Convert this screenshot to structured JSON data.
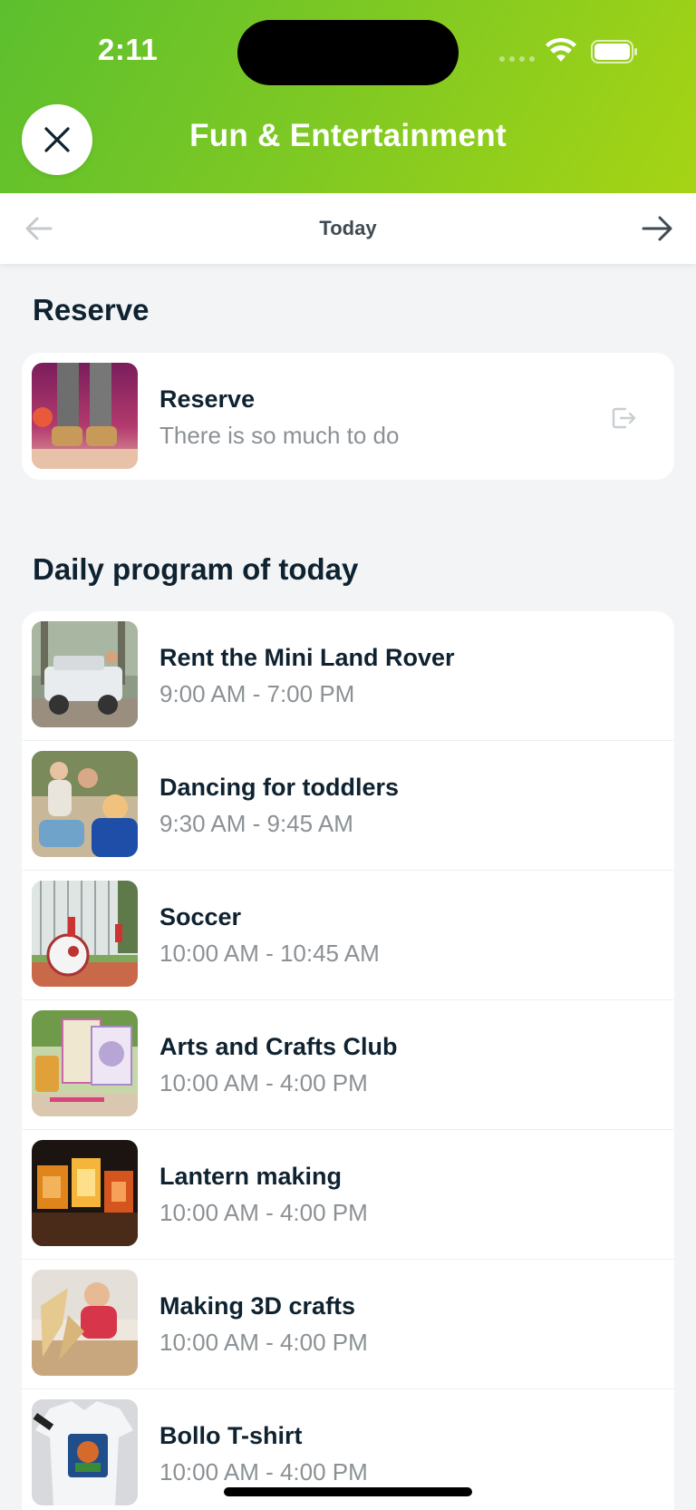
{
  "status_bar": {
    "time": "2:11"
  },
  "header": {
    "title": "Fun & Entertainment"
  },
  "date_nav": {
    "label": "Today"
  },
  "reserve_section": {
    "title": "Reserve",
    "item": {
      "title": "Reserve",
      "subtitle": "There is so much to do"
    }
  },
  "program_section": {
    "title": "Daily program of today",
    "items": [
      {
        "title": "Rent the Mini Land Rover",
        "time": "9:00 AM - 7:00 PM"
      },
      {
        "title": "Dancing for toddlers",
        "time": "9:30 AM - 9:45 AM"
      },
      {
        "title": "Soccer",
        "time": "10:00 AM - 10:45 AM"
      },
      {
        "title": "Arts and Crafts Club",
        "time": "10:00 AM - 4:00 PM"
      },
      {
        "title": "Lantern making",
        "time": "10:00 AM - 4:00 PM"
      },
      {
        "title": "Making 3D crafts",
        "time": "10:00 AM - 4:00 PM"
      },
      {
        "title": "Bollo T-shirt",
        "time": "10:00 AM - 4:00 PM"
      }
    ]
  },
  "colors": {
    "header_gradient_start": "#5cbf2e",
    "header_gradient_end": "#a6d414",
    "text_dark": "#0f2230",
    "text_muted": "#8b9195"
  }
}
